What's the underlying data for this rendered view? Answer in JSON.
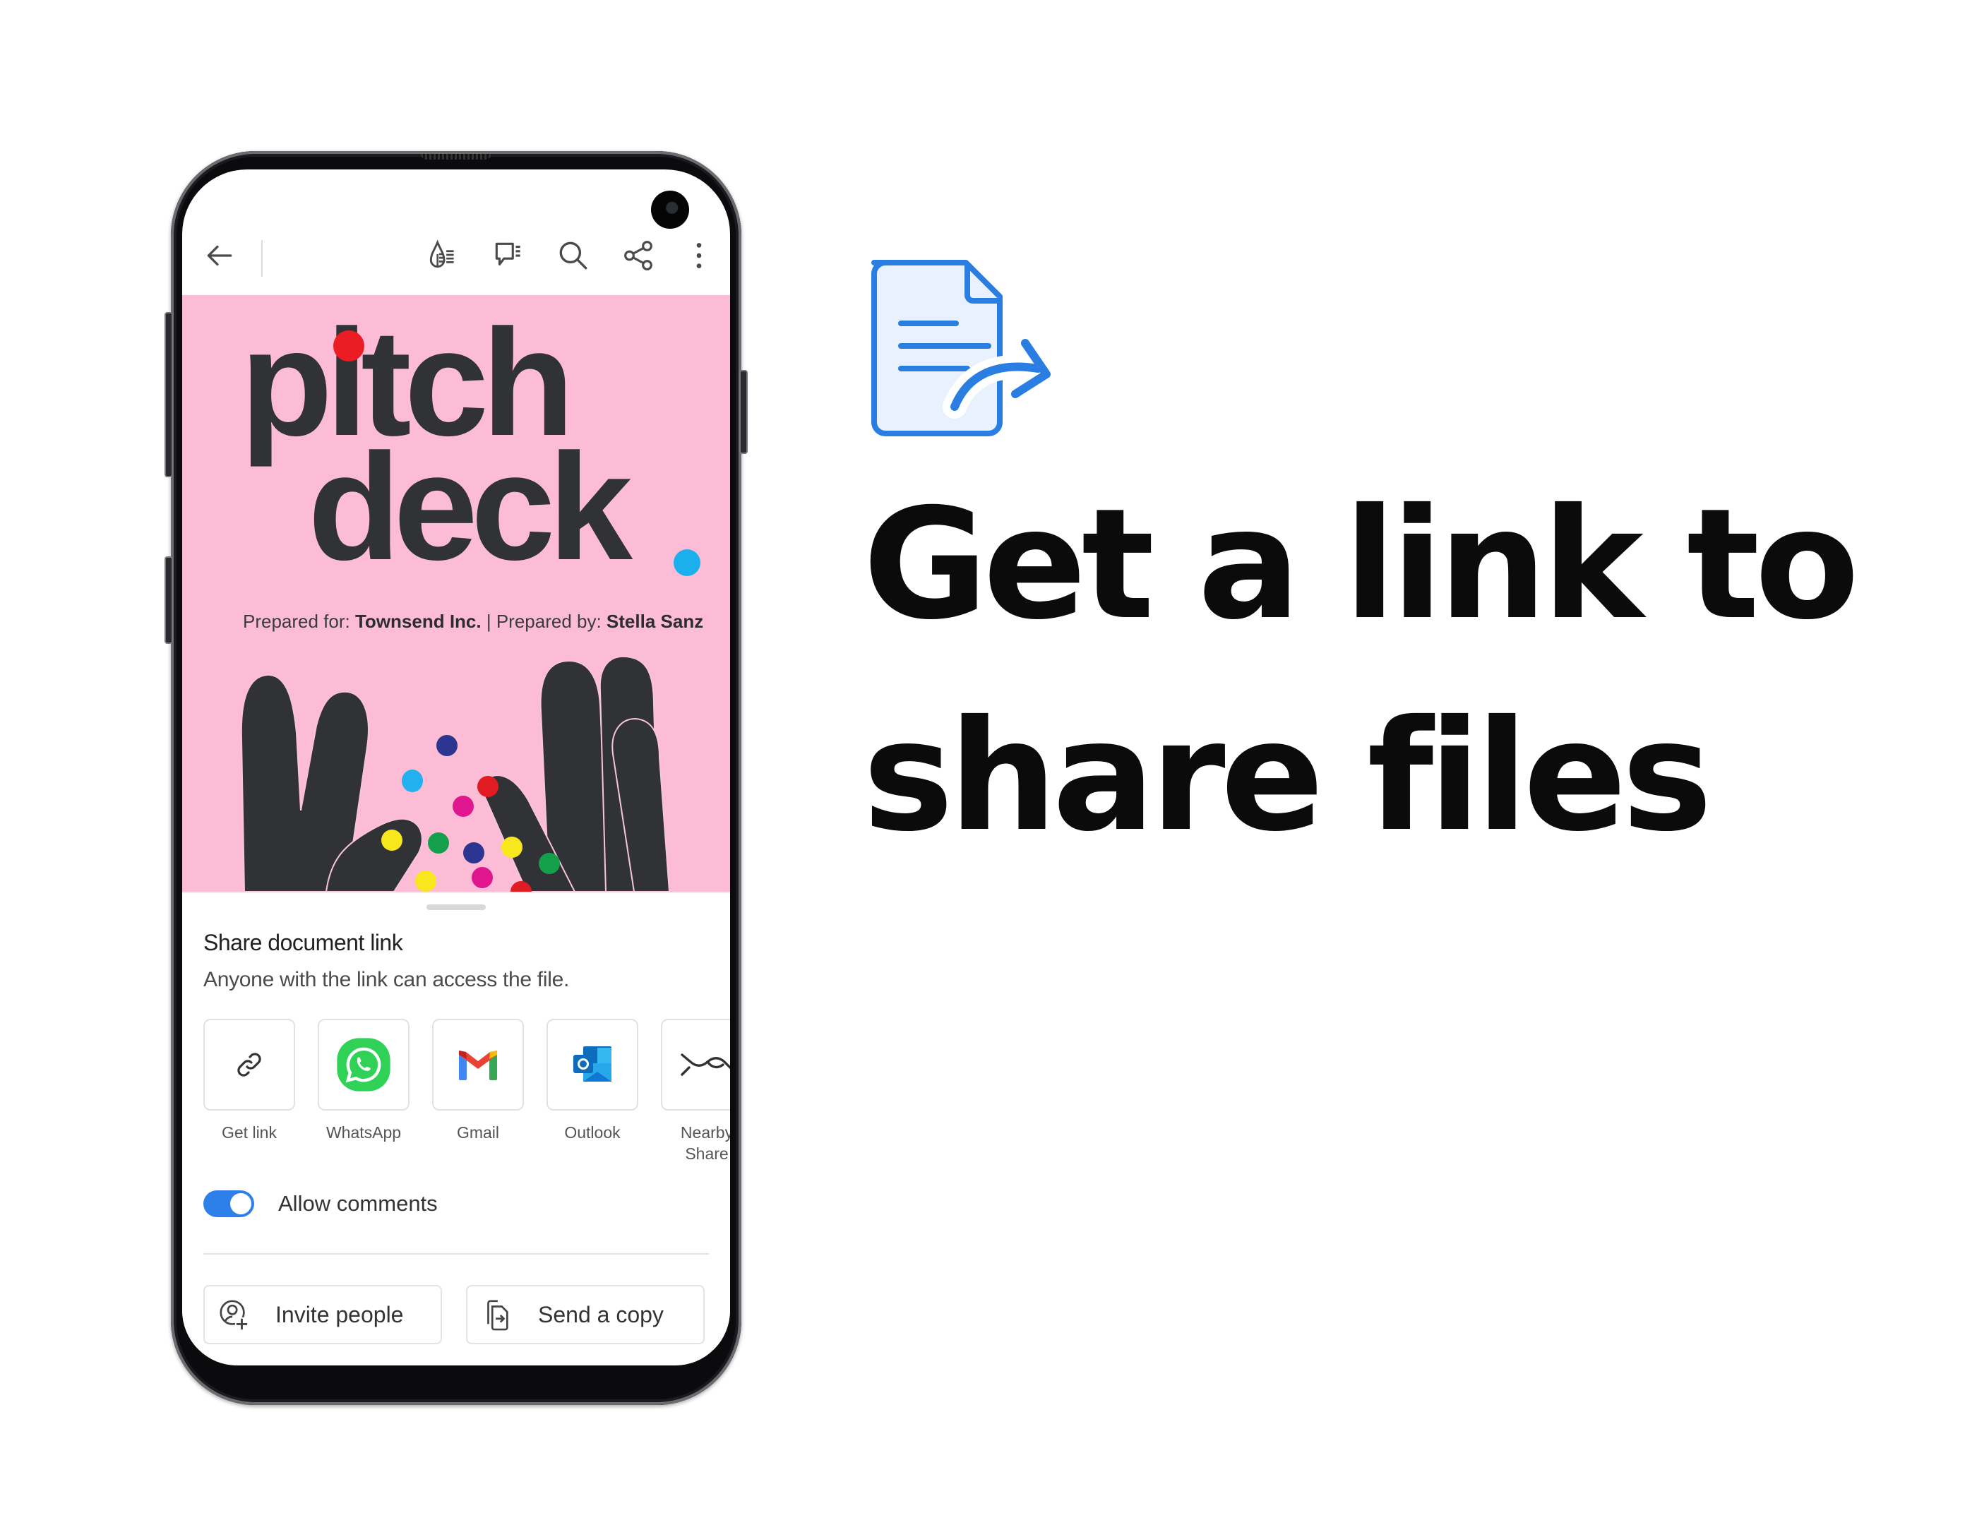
{
  "toolbar": {
    "back_icon": "arrow-left-icon",
    "icons": [
      "liquid-mode-icon",
      "comment-icon",
      "search-icon",
      "share-icon",
      "more-vertical-icon"
    ]
  },
  "document": {
    "title_line1": "pitch",
    "title_line2": "deck",
    "prepared_for_label": "Prepared for: ",
    "prepared_for_value": "Townsend Inc.",
    "separator": " | ",
    "prepared_by_label": "Prepared by: ",
    "prepared_by_value": "Stella Sanz",
    "colors": {
      "background": "#fdbcd6",
      "text": "#303236",
      "dot_red": "#ec1c24",
      "dot_blue": "#1ab0ee"
    }
  },
  "share_sheet": {
    "title": "Share document link",
    "description": "Anyone with the link can access the file.",
    "targets": [
      {
        "label": "Get link",
        "icon": "link-icon"
      },
      {
        "label": "WhatsApp",
        "icon": "whatsapp-icon"
      },
      {
        "label": "Gmail",
        "icon": "gmail-icon"
      },
      {
        "label": "Outlook",
        "icon": "outlook-icon"
      },
      {
        "label": "Nearby Share",
        "icon": "nearby-share-icon"
      }
    ],
    "allow_comments": {
      "label": "Allow comments",
      "enabled": true
    },
    "invite_button": "Invite people",
    "send_copy_button": "Send a copy",
    "accent_color": "#2d7fe9"
  },
  "hero": {
    "icon": "document-share-icon",
    "headline_line1": "Get a link to",
    "headline_line2": "share files",
    "icon_color": "#2a7de1"
  }
}
